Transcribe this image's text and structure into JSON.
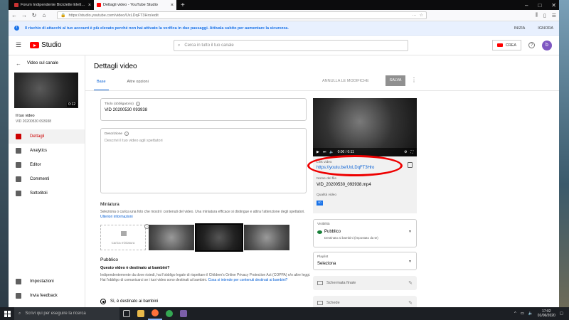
{
  "browser": {
    "tabs": [
      {
        "title": "Forum Indipendente Biciclette Elettriche"
      },
      {
        "title": "Dettagli video - YouTube Studio"
      }
    ],
    "url": "https://studio.youtube.com/video/UxLDqFT3Hro/edit",
    "warning": "Il rischio di attacchi al tuo account è più elevato perché non hai attivato la verifica in due passaggi. Attivala subito per aumentare la sicurezza.",
    "warning_actions": [
      "INIZIA",
      "IGNORA"
    ]
  },
  "studio": {
    "logo_text": "Studio",
    "search_placeholder": "Cerca in tutto il tuo canale",
    "create_label": "CREA",
    "avatar_letter": "b"
  },
  "sidebar": {
    "back_label": "Video sul canale",
    "thumb_duration": "0:12",
    "video_title": "Il tuo video",
    "video_id": "VID 20200530 093938",
    "items": [
      {
        "label": "Dettagli",
        "icon": "pencil-icon",
        "active": true
      },
      {
        "label": "Analytics",
        "icon": "chart-icon"
      },
      {
        "label": "Editor",
        "icon": "film-icon"
      },
      {
        "label": "Commenti",
        "icon": "comment-icon"
      },
      {
        "label": "Sottotitoli",
        "icon": "subtitles-icon"
      }
    ],
    "bottom_items": [
      {
        "label": "Impostazioni",
        "icon": "gear-icon"
      },
      {
        "label": "Invia feedback",
        "icon": "feedback-icon"
      }
    ]
  },
  "details": {
    "page_title": "Dettagli video",
    "tabs": [
      "Base",
      "Altre opzioni"
    ],
    "undo_label": "ANNULLA LE MODIFICHE",
    "save_label": "SALVA",
    "title_label": "Titolo (obbligatorio)",
    "title_value": "VID 20200530 093938",
    "description_label": "Descrizione",
    "description_placeholder": "Descrivi il tuo video agli spettatori",
    "thumbnail_heading": "Miniatura",
    "thumbnail_text": "Seleziona o carica una foto che mostri i contenuti del video. Una miniatura efficace si distingue e attira l'attenzione degli spettatori.",
    "thumbnail_link": "Ulteriori informazioni",
    "upload_label": "Carica miniatura",
    "audience_heading": "Pubblico",
    "audience_question": "Questo video è destinato ai bambini?",
    "audience_text": "Indipendentemente da dove risiedi, hai l'obbligo legale di rispettare il Children's Online Privacy Protection Act (COPPA) e/o altre leggi. Hai l'obbligo di comunicarci se i tuoi video sono destinati ai bambini.",
    "audience_link": "Cosa si intende per contenuti destinati ai bambini?",
    "radio_label": "Sì, è destinato ai bambini"
  },
  "video_panel": {
    "time": "0:00 / 0:11",
    "link_label": "Link video",
    "link_value": "https://youtu.be/UxLDqFT3Hro",
    "filename_label": "Nome del file",
    "filename_value": "VID_20200530_093938.mp4",
    "quality_label": "Qualità video",
    "quality_badge": "SD",
    "visibility_label": "Visibilità",
    "visibility_value": "Pubblico",
    "visibility_sub": "Destinato ai bambini (impostato da te)",
    "playlist_label": "Playlist",
    "playlist_value": "Seleziona",
    "endscreen_label": "Schermata finale",
    "cards_label": "Schede"
  },
  "taskbar": {
    "search_placeholder": "Scrivi qui per eseguire la ricerca",
    "time": "17:02",
    "date": "01/06/2020"
  },
  "colors": {
    "accent": "#065fd4",
    "brand_red": "#ff0000",
    "annotation_red": "#ee0000"
  }
}
